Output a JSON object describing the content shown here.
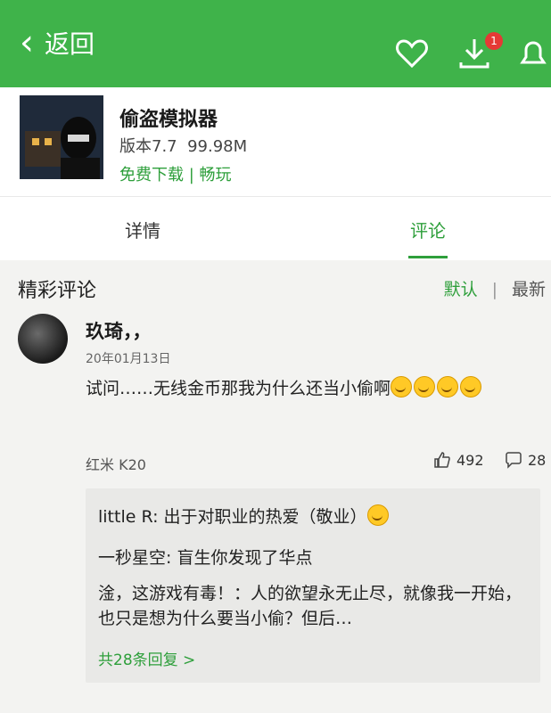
{
  "header": {
    "back_label": "返回",
    "download_badge": "1"
  },
  "app": {
    "name": "偷盗模拟器",
    "version": "版本7.7",
    "size": "99.98M",
    "free_download": "免费下载",
    "separator": "|",
    "smooth_play": "畅玩"
  },
  "tabs": {
    "details": "详情",
    "reviews": "评论"
  },
  "section": {
    "title": "精彩评论",
    "sort_default": "默认",
    "sort_sep": "|",
    "sort_latest": "最新"
  },
  "review": {
    "username": "玖琦，，",
    "date": "20年01月13日",
    "text": "试问……无线金币那我为什么还当小偷啊",
    "device": "红米 K20",
    "likes": "492",
    "reply_count": "28",
    "replies": [
      {
        "text": "little R: 出于对职业的热爱（敬业）"
      },
      {
        "text": "一秒星空: 盲生你发现了华点"
      },
      {
        "text": "淦，这游戏有毒！：人的欲望永无止尽，就像我一开始，也只是想为什么要当小偷？但后…"
      }
    ],
    "more_replies": "共28条回复 >"
  },
  "colors": {
    "brand_green": "#3fb34a",
    "accent_green": "#2e9f3b",
    "badge_red": "#e53935"
  }
}
